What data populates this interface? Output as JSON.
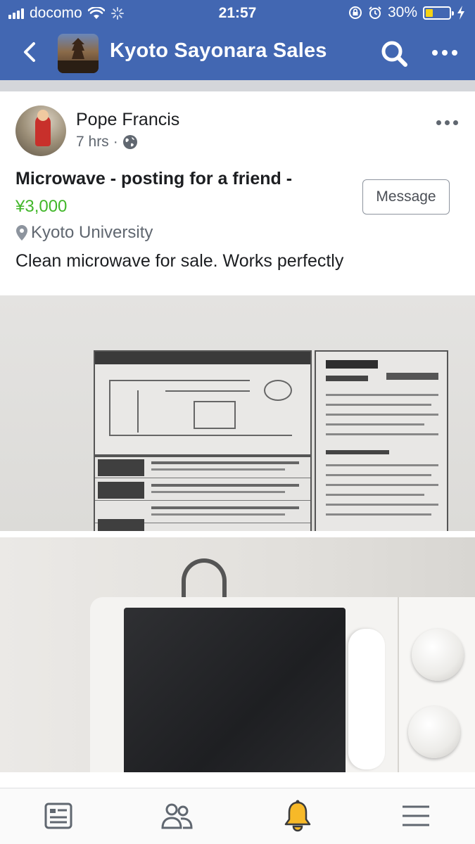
{
  "status_bar": {
    "carrier": "docomo",
    "time": "21:57",
    "battery_percent": "30%",
    "battery_level": 0.3,
    "icons": [
      "signal-icon",
      "wifi-icon",
      "loading-icon",
      "orientation-lock-icon",
      "alarm-icon",
      "battery-icon",
      "charging-icon"
    ]
  },
  "nav": {
    "title": "Kyoto Sayonara Sales",
    "back_icon": "chevron-left-icon",
    "search_icon": "search-icon",
    "more_icon": "more-horizontal-icon"
  },
  "post": {
    "author": "Pope Francis",
    "time": "7 hrs",
    "separator": "·",
    "privacy_icon": "globe-icon",
    "listing_title": "Microwave - posting for a friend -",
    "price": "¥3,000",
    "location": "Kyoto University",
    "description": "Clean microwave for sale. Works perfectly",
    "message_button": "Message"
  },
  "tab_bar": {
    "tabs": [
      {
        "name": "news-feed",
        "icon": "news-feed-icon"
      },
      {
        "name": "groups",
        "icon": "people-icon"
      },
      {
        "name": "notifications",
        "icon": "bell-icon",
        "active_color": "#f7b928"
      },
      {
        "name": "menu",
        "icon": "hamburger-menu-icon"
      }
    ]
  },
  "colors": {
    "header_blue": "#4267b2",
    "price_green": "#42b72a",
    "secondary_text": "#606770",
    "bell_yellow": "#f7b928"
  }
}
